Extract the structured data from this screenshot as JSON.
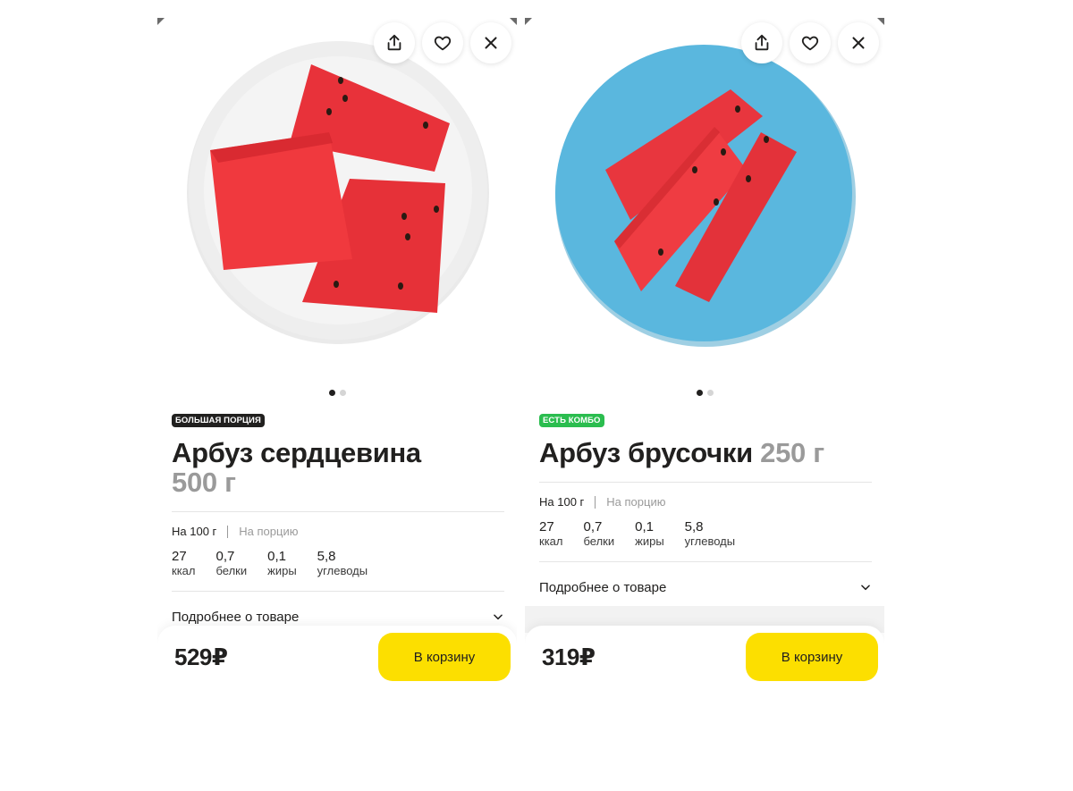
{
  "cards": [
    {
      "badge": "Большая порция",
      "title": "Арбуз сердцевина",
      "weight": "500 г",
      "nutrition_tabs": [
        "На 100 г",
        "На порцию"
      ],
      "nutrition": [
        {
          "value": "27",
          "label": "ккал"
        },
        {
          "value": "0,7",
          "label": "белки"
        },
        {
          "value": "0,1",
          "label": "жиры"
        },
        {
          "value": "5,8",
          "label": "углеводы"
        }
      ],
      "more_label": "Подробнее о товаре",
      "price": "529₽",
      "cart_label": "В корзину",
      "plate_color": "#e9e9e9",
      "pager": {
        "current": 1,
        "total": 2
      }
    },
    {
      "badge": "Есть комбо",
      "title": "Арбуз брусочки",
      "weight": "250 г",
      "nutrition_tabs": [
        "На 100 г",
        "На порцию"
      ],
      "nutrition": [
        {
          "value": "27",
          "label": "ккал"
        },
        {
          "value": "0,7",
          "label": "белки"
        },
        {
          "value": "0,1",
          "label": "жиры"
        },
        {
          "value": "5,8",
          "label": "углеводы"
        }
      ],
      "more_label": "Подробнее о товаре",
      "price": "319₽",
      "cart_label": "В корзину",
      "plate_color": "#5ab7de",
      "pager": {
        "current": 1,
        "total": 2
      }
    }
  ],
  "icons": [
    "share-icon",
    "heart-icon",
    "close-icon",
    "chevron-down-icon"
  ],
  "colors": {
    "accent_yellow": "#fcdf00",
    "badge_dark": "#21201f",
    "badge_green": "#2bbd4f",
    "weight_gray": "#9a9a9a"
  }
}
